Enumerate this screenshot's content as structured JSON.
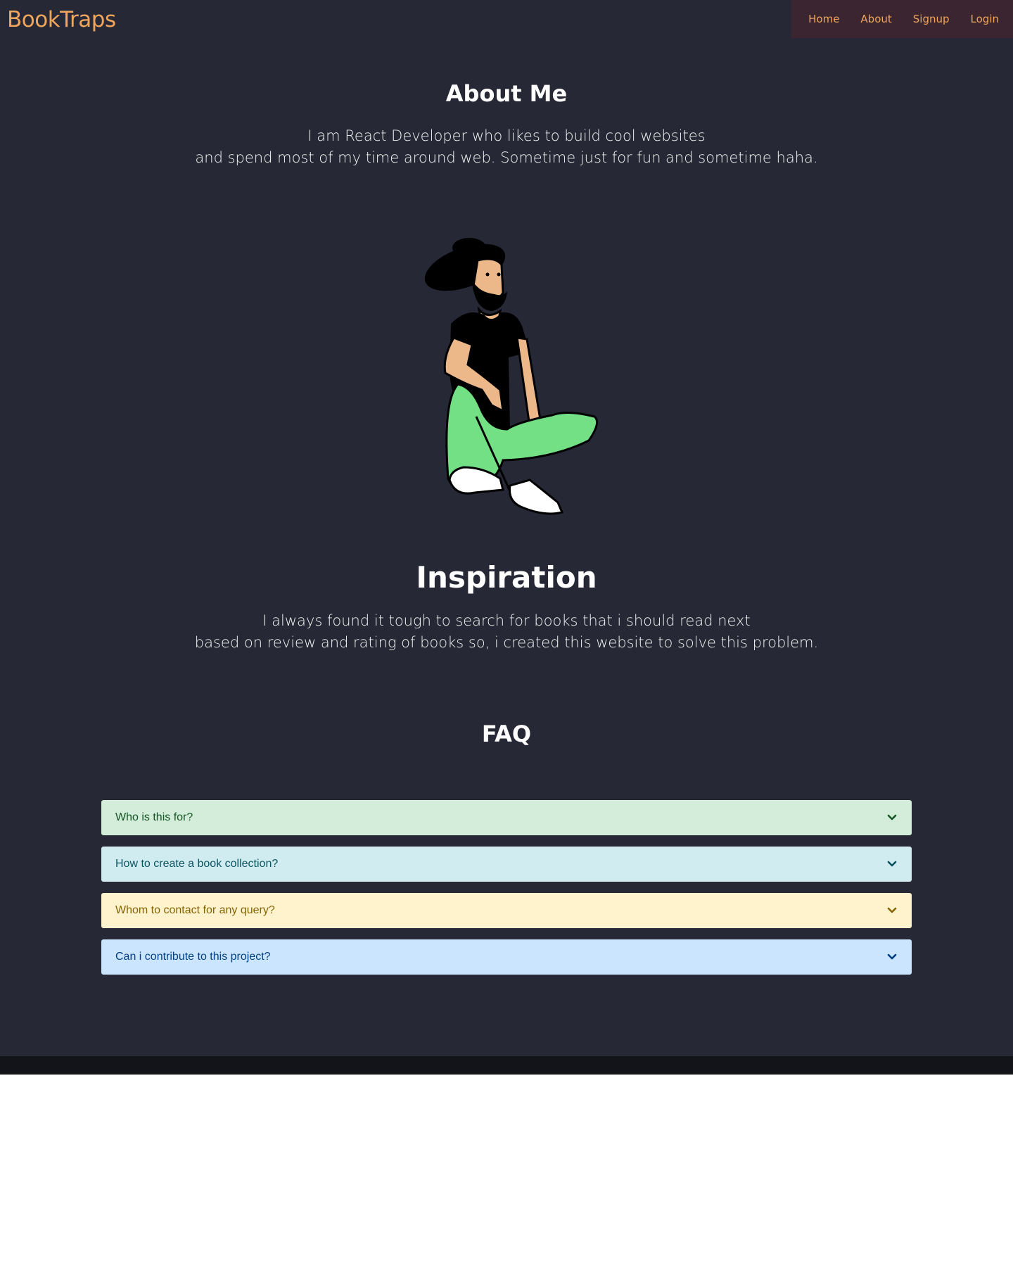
{
  "header": {
    "brand": "BookTraps",
    "nav": [
      {
        "label": "Home"
      },
      {
        "label": "About"
      },
      {
        "label": "Signup"
      },
      {
        "label": "Login"
      }
    ]
  },
  "about": {
    "title": "About Me",
    "line1": "I am React Developer who likes to build cool websites",
    "line2": "and spend most of my time around web. Sometime just for fun and sometime haha."
  },
  "inspiration": {
    "title": "Inspiration",
    "line1": "I always found it tough to search for books that i should read next",
    "line2": "based on review and rating of books so, i created this website to solve this problem."
  },
  "faq": {
    "title": "FAQ",
    "items": [
      {
        "question": "Who is this for?",
        "bg": "#d4edda",
        "color": "#155724"
      },
      {
        "question": "How to create a book collection?",
        "bg": "#d1ecf1",
        "color": "#0c5460"
      },
      {
        "question": "Whom to contact for any query?",
        "bg": "#fff3cd",
        "color": "#856404"
      },
      {
        "question": "Can i contribute to this project?",
        "bg": "#cce5ff",
        "color": "#004085"
      }
    ]
  },
  "colors": {
    "background": "#262935",
    "accent": "#f0a55a",
    "nav_bg": "#3a2530",
    "footer": "#131419"
  },
  "icons": {
    "faq_toggle": "chevron-down-icon",
    "illustration": "sitting-man-illustration"
  }
}
